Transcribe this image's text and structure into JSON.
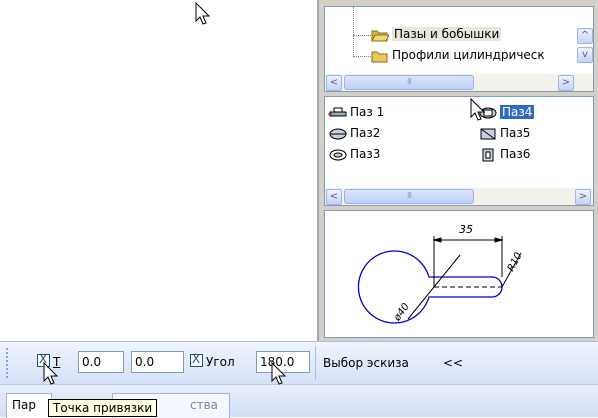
{
  "library_tree": {
    "items": [
      {
        "label": "Пазы и бобышки",
        "icon": "folder-open-icon",
        "selected": true
      },
      {
        "label": "Профили цилиндрическ",
        "icon": "folder-icon",
        "selected": false
      }
    ],
    "scroll_up": "^",
    "scroll_down": "v",
    "scroll_left": "<",
    "scroll_right": ">",
    "thumb_grip": "III"
  },
  "sketch_list": {
    "items": [
      {
        "label": "Паз 1",
        "icon": "slot-1-icon",
        "selected": false
      },
      {
        "label": "Паз4",
        "icon": "slot-4-icon",
        "selected": true
      },
      {
        "label": "Паз2",
        "icon": "slot-2-icon",
        "selected": false
      },
      {
        "label": "Паз5",
        "icon": "slot-5-icon",
        "selected": false
      },
      {
        "label": "Паз3",
        "icon": "slot-3-icon",
        "selected": false
      },
      {
        "label": "Паз6",
        "icon": "slot-6-icon",
        "selected": false
      }
    ],
    "scroll_left": "<",
    "scroll_right": ">",
    "thumb_grip": "III"
  },
  "preview": {
    "dim_length": "35",
    "dim_width": "R10",
    "dim_diameter": "ø40"
  },
  "toolbar": {
    "point_checkbox_mark": "X",
    "point_label": "T",
    "x_value": "0.0",
    "y_value": "0.0",
    "angle_checkbox_mark": "X",
    "angle_label": "Угол",
    "angle_value": "180.0",
    "sketch_select_label": "Выбор эскиза",
    "collapse_label": "<<"
  },
  "tabs": {
    "tab1": "Пар",
    "tab2": "ства"
  },
  "tooltip": "Точка привязки",
  "colors": {
    "selection": "#316ac5",
    "toolbar_bg": "#dde7fa",
    "preview_ink": "#0000cc"
  }
}
